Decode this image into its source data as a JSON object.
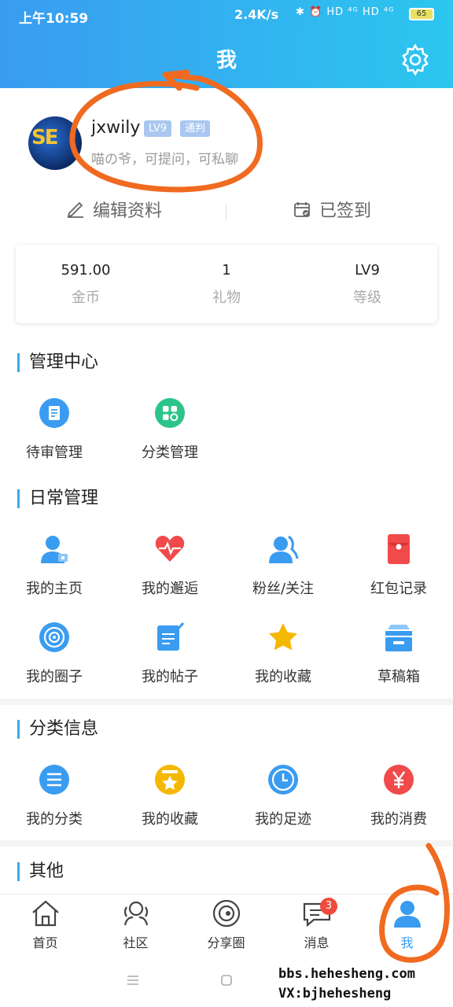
{
  "status_bar": {
    "time": "上午10:59",
    "network_speed": "2.4K/s",
    "indicators": "✱ ⏰ HD ⁴ᴳ HD ⁴ᴳ",
    "battery": "65"
  },
  "header": {
    "title": "我",
    "settings_icon": "gear-icon"
  },
  "profile": {
    "username": "jxwily",
    "level_badge": "LV9",
    "role_badge": "通判",
    "signature": "喵の爷，可提问，可私聊"
  },
  "actions": {
    "edit_profile": "编辑资料",
    "checkin": "已签到"
  },
  "stats": [
    {
      "value": "591.00",
      "label": "金币"
    },
    {
      "value": "1",
      "label": "礼物"
    },
    {
      "value": "LV9",
      "label": "等级"
    }
  ],
  "sections": {
    "admin": {
      "title": "管理中心",
      "items": [
        {
          "label": "待审管理",
          "icon": "review-doc-icon",
          "color": "#3a9cf0"
        },
        {
          "label": "分类管理",
          "icon": "category-grid-icon",
          "color": "#2cc48a"
        }
      ]
    },
    "daily": {
      "title": "日常管理",
      "items": [
        {
          "label": "我的主页",
          "icon": "user-home-icon",
          "color": "#3a9cf0"
        },
        {
          "label": "我的邂逅",
          "icon": "heart-pulse-icon",
          "color": "#f04a4a"
        },
        {
          "label": "粉丝/关注",
          "icon": "followers-icon",
          "color": "#3a9cf0"
        },
        {
          "label": "红包记录",
          "icon": "red-envelope-icon",
          "color": "#f04a4a"
        },
        {
          "label": "我的圈子",
          "icon": "circle-target-icon",
          "color": "#3a9cf0"
        },
        {
          "label": "我的帖子",
          "icon": "post-edit-icon",
          "color": "#3a9cf0"
        },
        {
          "label": "我的收藏",
          "icon": "star-icon",
          "color": "#f5b800"
        },
        {
          "label": "草稿箱",
          "icon": "draft-box-icon",
          "color": "#3a9cf0"
        }
      ]
    },
    "classified": {
      "title": "分类信息",
      "items": [
        {
          "label": "我的分类",
          "icon": "list-icon",
          "color": "#3a9cf0"
        },
        {
          "label": "我的收藏",
          "icon": "star-box-icon",
          "color": "#f5b800"
        },
        {
          "label": "我的足迹",
          "icon": "clock-icon",
          "color": "#3a9cf0"
        },
        {
          "label": "我的消费",
          "icon": "yen-icon",
          "color": "#f04a4a"
        }
      ]
    },
    "other": {
      "title": "其他"
    }
  },
  "tabbar": [
    {
      "label": "首页",
      "icon": "home-icon"
    },
    {
      "label": "社区",
      "icon": "community-icon"
    },
    {
      "label": "分享圈",
      "icon": "share-circle-icon"
    },
    {
      "label": "消息",
      "icon": "message-icon",
      "badge": "3"
    },
    {
      "label": "我",
      "icon": "me-icon",
      "active": true
    }
  ],
  "watermark": {
    "line1": "bbs.hehesheng.com",
    "line2": "VX:bjhehesheng"
  },
  "colors": {
    "header": "#3a9cf0",
    "accent": "#3aa8e8",
    "annotation": "#f06a20"
  }
}
